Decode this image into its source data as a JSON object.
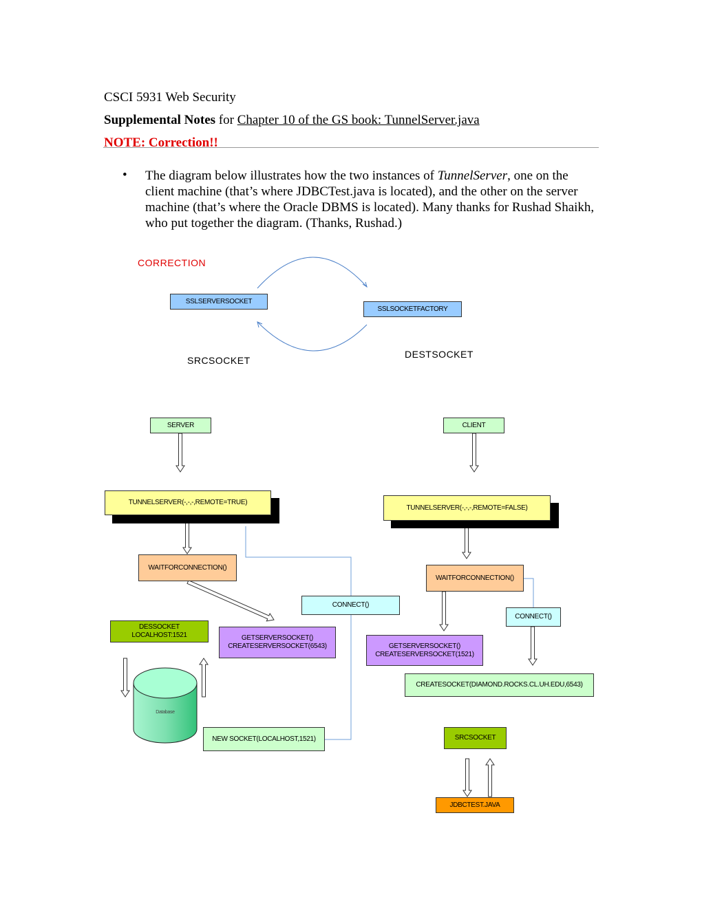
{
  "header": {
    "course": "CSCI 5931 Web Security",
    "notes_bold": "Supplemental Notes",
    "notes_for": " for ",
    "notes_link": "Chapter 10 of the GS book: TunnelServer.java",
    "note": "NOTE: Correction!!"
  },
  "body": {
    "bullet": "•",
    "para_1": "The diagram below illustrates how the two instances of ",
    "para_em": "TunnelServer",
    "para_2": ", one on the client machine (that’s where JDBCTest.java is located), and the other on the server machine (that’s where the Oracle DBMS is located). Many thanks for Rushad Shaikh, who put together the diagram. (Thanks, Rushad.)"
  },
  "diagram": {
    "correction": "CORRECTION",
    "srcsocket_label": "SRCSOCKET",
    "destsocket_label": "DESTSOCKET",
    "sslserversocket": "SSLSERVERSOCKET",
    "sslsocketfactory": "SSLSOCKETFACTORY",
    "server": "SERVER",
    "client": "CLIENT",
    "tunnel_left": "TUNNELSERVER(-,-,-,REMOTE=TRUE)",
    "tunnel_right": "TUNNELSERVER(-,-,-,REMOTE=FALSE)",
    "wait_left": "WAITFORCONNECTION()",
    "wait_right": "WAITFORCONNECTION()",
    "connect_center": "CONNECT()",
    "connect_right": "CONNECT()",
    "dessocket_1": "DESSOCKET",
    "dessocket_2": "LOCALHOST:1521",
    "getserver_left_1": "GETSERVERSOCKET()",
    "getserver_left_2": "CREATESERVERSOCKET(6543)",
    "getserver_right_1": "GETSERVERSOCKET()",
    "getserver_right_2": "CREATESERVERSOCKET(1521)",
    "createsocket": "CREATESOCKET(DIAMOND.ROCKS.CL.UH.EDU,6543)",
    "database": "Database",
    "newsocket": "NEW SOCKET(LOCALHOST,1521)",
    "srcsocket_box": "SRCSOCKET",
    "jdbctest": "JDBCTEST.JAVA"
  },
  "colors": {
    "red": "#e00000",
    "blue_box": "#99ccff",
    "light_green": "#ccffcc",
    "yellow": "#ffff99",
    "peach": "#ffcc99",
    "cyan": "#ccffff",
    "olive_green": "#99cc00",
    "purple": "#cc99ff",
    "orange": "#ff9900",
    "connector": "#6f9fd8"
  }
}
